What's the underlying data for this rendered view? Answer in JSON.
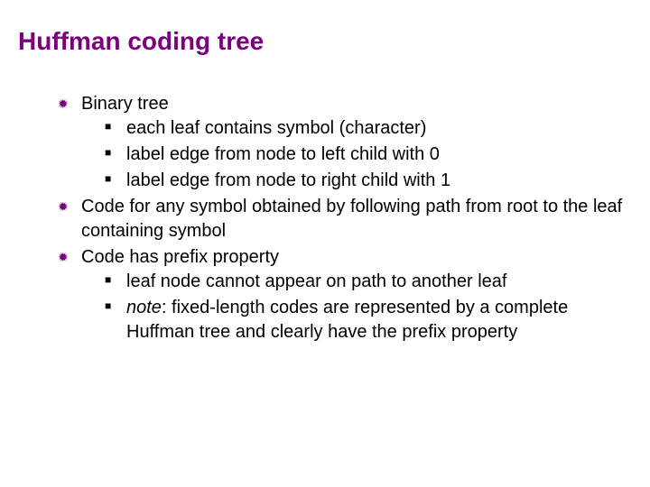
{
  "title": "Huffman coding tree",
  "items": [
    {
      "text": "Binary tree",
      "sub": [
        "each leaf contains symbol (character)",
        "label edge from node to left child with 0",
        "label edge from node to right child with 1"
      ]
    },
    {
      "text": "Code for any symbol obtained by following path from root to the leaf containing symbol",
      "sub": []
    },
    {
      "text": "Code has prefix property",
      "sub": [
        "leaf node cannot appear on path to another leaf",
        {
          "note_prefix": "note",
          "rest": ": fixed-length codes are represented by a complete Huffman tree and clearly have the prefix property"
        }
      ]
    }
  ]
}
